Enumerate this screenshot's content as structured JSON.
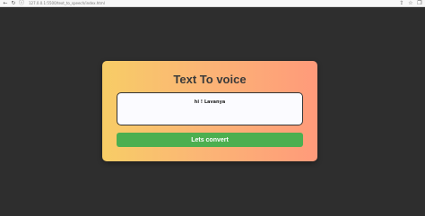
{
  "browser": {
    "address": "127.0.0.1:5500/text_to_speech/index.html",
    "icons": [
      "back-icon",
      "refresh-icon",
      "info-icon",
      "share-icon",
      "star-icon",
      "collections-icon"
    ]
  },
  "card": {
    "title": "Text To voice",
    "textarea_value": "hi ! Lavanya",
    "convert_label": "Lets convert"
  },
  "colors": {
    "gradient_start": "#f7cd66",
    "gradient_end": "#ff9a7a",
    "button": "#4caf50",
    "background": "#2e2e2e"
  }
}
